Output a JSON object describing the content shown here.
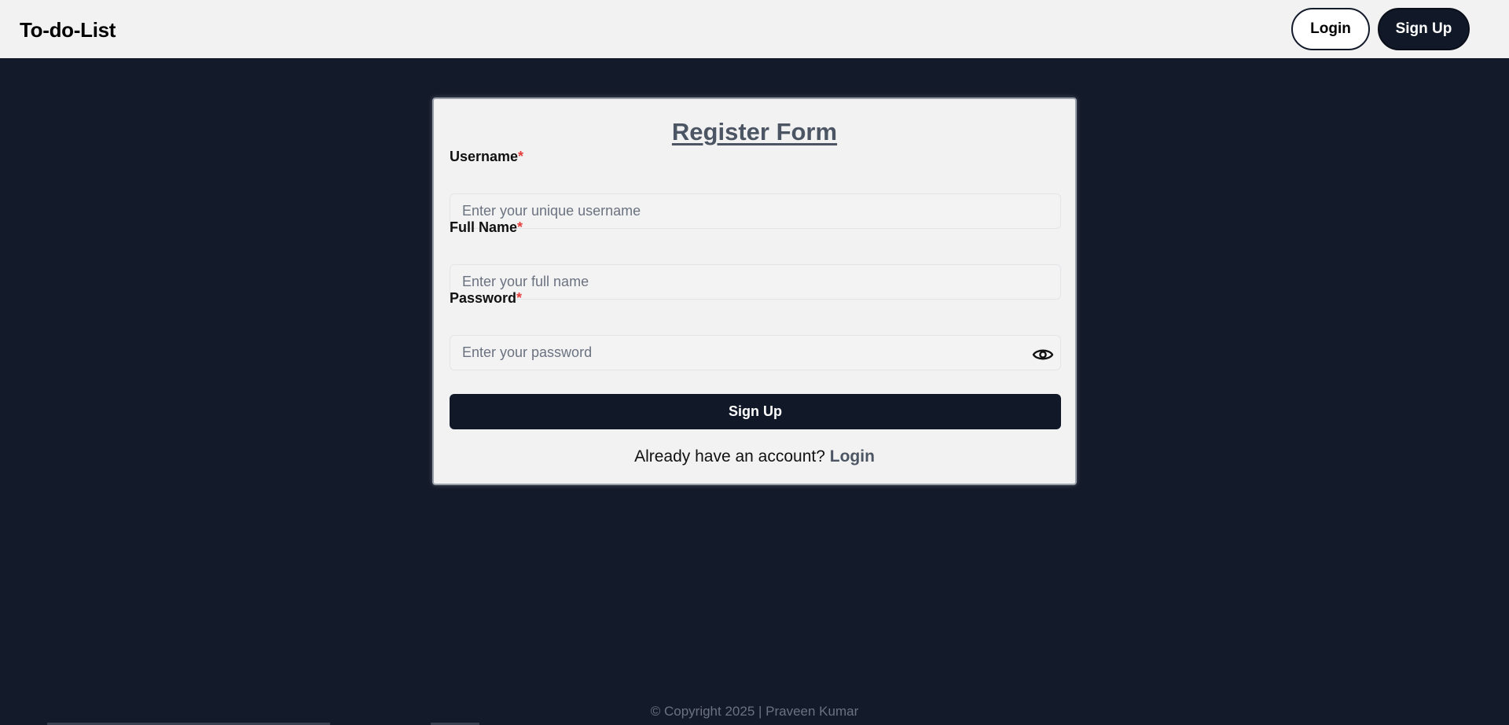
{
  "navbar": {
    "brand": "To-do-List",
    "login_label": "Login",
    "signup_label": "Sign Up"
  },
  "form": {
    "title": "Register Form",
    "required_marker": "*",
    "fields": [
      {
        "label": "Username",
        "placeholder": "Enter your unique username",
        "value": ""
      },
      {
        "label": "Full Name",
        "placeholder": "Enter your full name",
        "value": ""
      },
      {
        "label": "Password",
        "placeholder": "Enter your password",
        "value": "",
        "icon": "eye-icon"
      }
    ],
    "submit_label": "Sign Up",
    "switch_prompt": "Already have an account?",
    "switch_link": "Login"
  },
  "footer": {
    "text": "© Copyright 2025 | Praveen Kumar"
  },
  "colors": {
    "page_bg": "#131a2a",
    "navbar_bg": "#f2f2f2",
    "primary_button": "#111827",
    "title_color": "#4b5563",
    "required_color": "#e53e3e"
  }
}
